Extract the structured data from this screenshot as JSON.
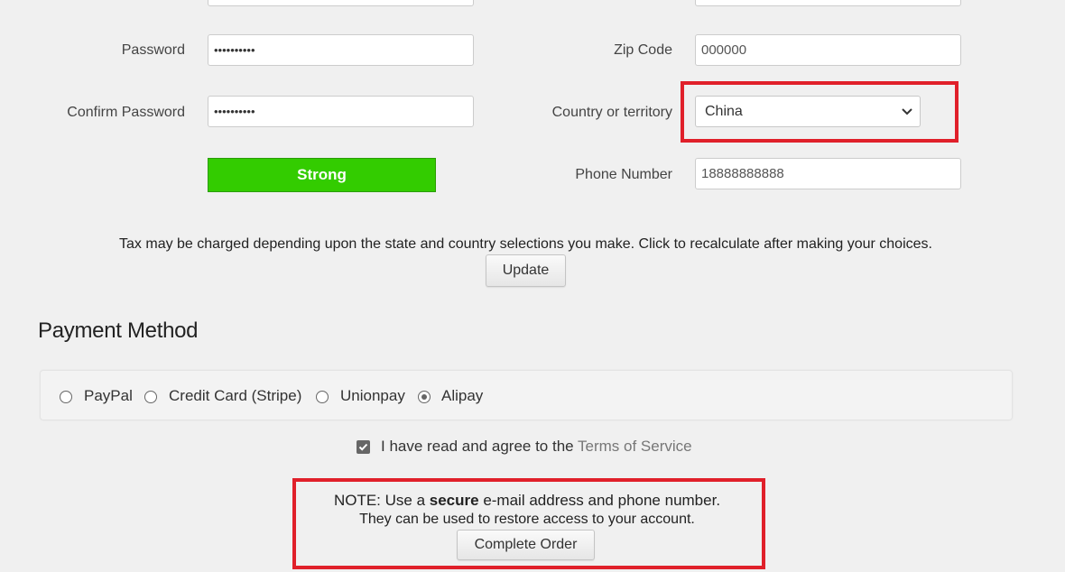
{
  "top_inputs": {
    "left_value": "",
    "right_value": ""
  },
  "account": {
    "password_label": "Password",
    "password_value": "••••••••••",
    "confirm_password_label": "Confirm Password",
    "confirm_password_value": "••••••••••",
    "strength_text": "Strong",
    "zip_label": "Zip Code",
    "zip_value": "000000",
    "country_label": "Country or territory",
    "country_value": "China",
    "phone_label": "Phone Number",
    "phone_value": "18888888888"
  },
  "tax": {
    "notice": "Tax may be charged depending upon the state and country selections you make. Click to recalculate after making your choices.",
    "update_label": "Update"
  },
  "payment": {
    "title": "Payment Method",
    "options": [
      {
        "label": "PayPal",
        "checked": false
      },
      {
        "label": "Credit Card (Stripe)",
        "checked": false
      },
      {
        "label": "Unionpay",
        "checked": false
      },
      {
        "label": "Alipay",
        "checked": true
      }
    ]
  },
  "terms": {
    "checked": true,
    "prefix": "I have read and agree to the ",
    "link_text": "Terms of Service"
  },
  "note": {
    "line1_prefix": "NOTE: Use a ",
    "line1_bold": "secure",
    "line1_suffix": " e-mail address and phone number.",
    "line2": "They can be used to restore access to your account.",
    "complete_label": "Complete Order"
  },
  "colors": {
    "strength_green": "#33cc00",
    "highlight_red": "#e0202a",
    "background": "#f0f0f0"
  }
}
